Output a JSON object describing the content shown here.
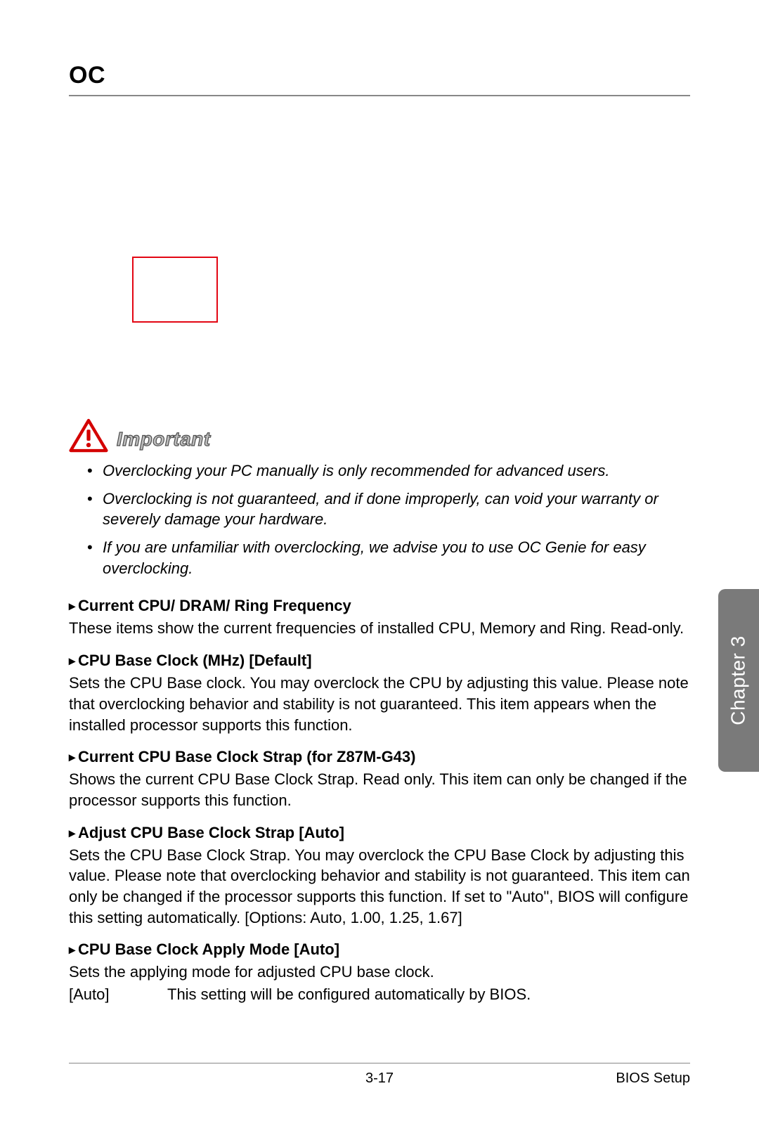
{
  "title": "OC",
  "important_label": "Important",
  "bullets": [
    "Overclocking your PC manually is only recommended for advanced users.",
    "Overclocking is not guaranteed, and if done improperly, can void your warranty or severely damage your hardware.",
    "If you are unfamiliar with overclocking, we advise you to use OC Genie for easy overclocking."
  ],
  "sections": [
    {
      "heading": "Current CPU/ DRAM/ Ring Frequency",
      "body": "These items show the current frequencies of installed CPU, Memory and Ring. Read-only."
    },
    {
      "heading": "CPU Base Clock (MHz) [Default]",
      "body": "Sets the CPU Base clock. You may overclock the CPU by adjusting this value. Please note that overclocking behavior and stability is not guaranteed. This item appears when the installed processor supports this function."
    },
    {
      "heading": "Current CPU Base Clock Strap (for Z87M-G43)",
      "body": "Shows the current CPU Base Clock Strap. Read only. This item can only be changed if the processor supports this function."
    },
    {
      "heading": "Adjust CPU Base Clock Strap [Auto]",
      "body": "Sets the CPU Base Clock Strap. You may overclock the CPU Base Clock by adjusting this value. Please note that overclocking behavior and stability is not guaranteed. This item can only be changed if the processor supports this function. If set to \"Auto\", BIOS will configure this setting automatically. [Options: Auto, 1.00, 1.25, 1.67]"
    },
    {
      "heading": "CPU Base Clock Apply Mode [Auto]",
      "body": "Sets the applying mode for adjusted CPU base clock.",
      "options": [
        {
          "key": "[Auto]",
          "desc": "This setting will be configured automatically by BIOS."
        }
      ]
    }
  ],
  "chapter_tab": "Chapter 3",
  "footer": {
    "page_number": "3-17",
    "section_title": "BIOS Setup"
  }
}
